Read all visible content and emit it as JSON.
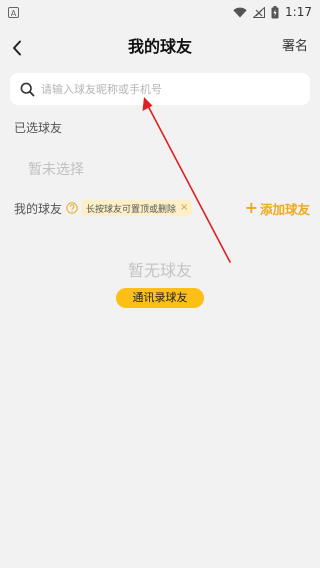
{
  "status_bar": {
    "left_icon_letter": "A",
    "time": "1:17"
  },
  "header": {
    "title": "我的球友",
    "right_button": "署名"
  },
  "search": {
    "placeholder": "请输入球友昵称或手机号",
    "value": ""
  },
  "selected_section": {
    "title": "已选球友",
    "empty_text": "暂未选择"
  },
  "friends_section": {
    "title": "我的球友",
    "tip_text": "长按球友可置顶或删除",
    "tip_close": "×",
    "add_label": "添加球友",
    "add_plus": "+"
  },
  "empty_state": {
    "text": "暂无球友",
    "button_label": "通讯录球友"
  },
  "colors": {
    "accent": "#f0a81e",
    "button_yellow": "#fbbf16",
    "tip_bg": "#fdf0c8",
    "annotation_red": "#e02020"
  }
}
